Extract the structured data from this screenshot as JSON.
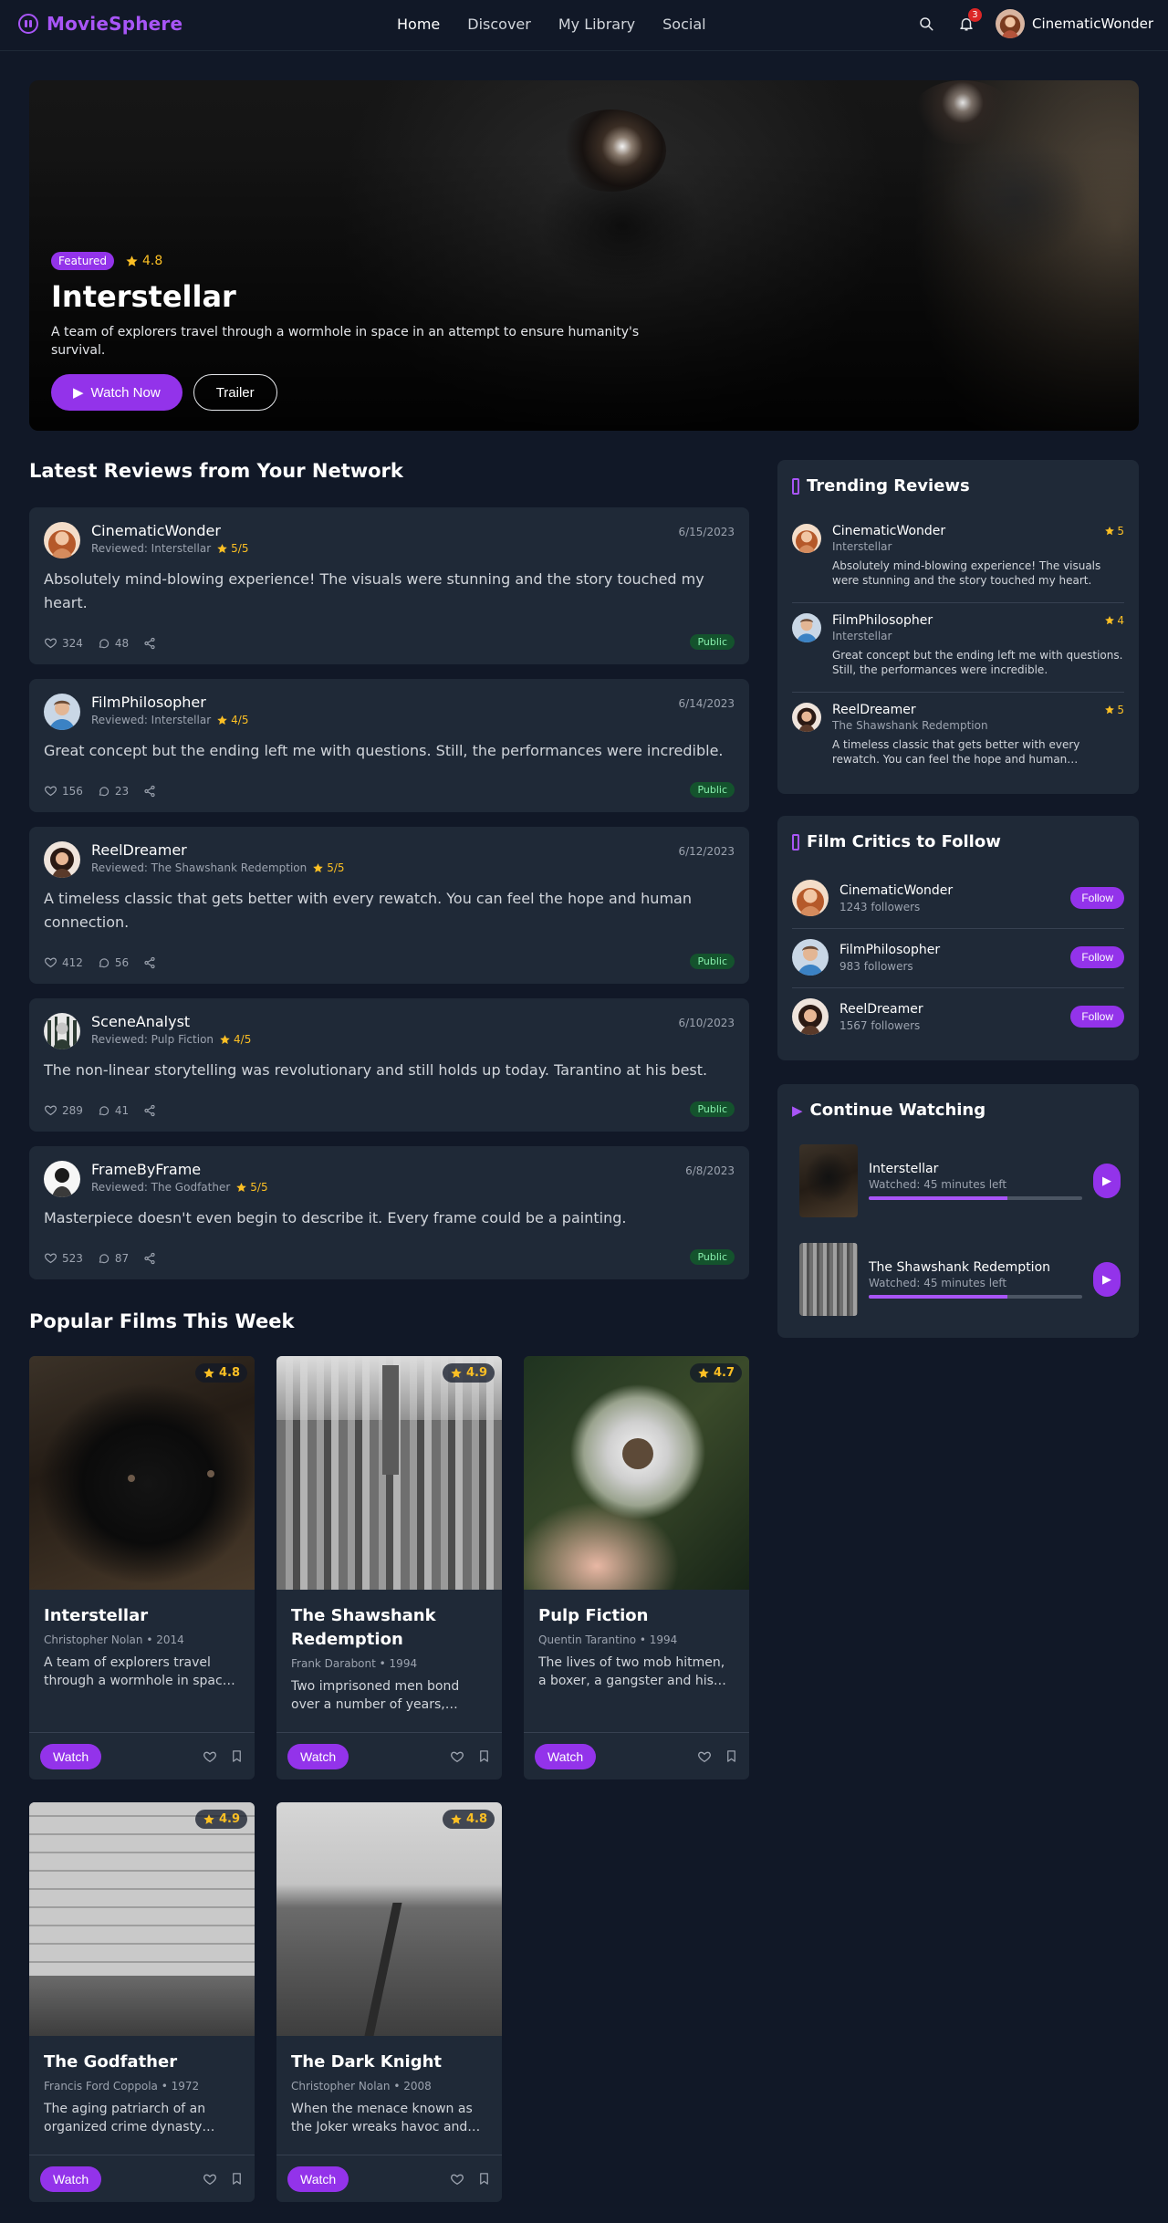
{
  "app": {
    "name": "MovieSphere"
  },
  "nav": {
    "links": [
      "Home",
      "Discover",
      "My Library",
      "Social"
    ],
    "active": "Home",
    "notification_count": "3",
    "user": "CinematicWonder",
    "icons": [
      "search-icon",
      "bell-icon"
    ]
  },
  "hero": {
    "tag": "Featured",
    "rating": "4.8",
    "title": "Interstellar",
    "description": "A team of explorers travel through a wormhole in space in an attempt to ensure humanity's survival.",
    "watch_label": "Watch Now",
    "trailer_label": "Trailer"
  },
  "reviews_section": {
    "title": "Latest Reviews from Your Network",
    "reviews": [
      {
        "user": "CinematicWonder",
        "reviewed": "Reviewed: Interstellar",
        "rating": "5/5",
        "date": "6/15/2023",
        "text": "Absolutely mind-blowing experience! The visuals were stunning and the story touched my heart.",
        "likes": "324",
        "comments": "48",
        "visibility": "Public"
      },
      {
        "user": "FilmPhilosopher",
        "reviewed": "Reviewed: Interstellar",
        "rating": "4/5",
        "date": "6/14/2023",
        "text": "Great concept but the ending left me with questions. Still, the performances were incredible.",
        "likes": "156",
        "comments": "23",
        "visibility": "Public"
      },
      {
        "user": "ReelDreamer",
        "reviewed": "Reviewed: The Shawshank Redemption",
        "rating": "5/5",
        "date": "6/12/2023",
        "text": "A timeless classic that gets better with every rewatch. You can feel the hope and human connection.",
        "likes": "412",
        "comments": "56",
        "visibility": "Public"
      },
      {
        "user": "SceneAnalyst",
        "reviewed": "Reviewed: Pulp Fiction",
        "rating": "4/5",
        "date": "6/10/2023",
        "text": "The non-linear storytelling was revolutionary and still holds up today. Tarantino at his best.",
        "likes": "289",
        "comments": "41",
        "visibility": "Public"
      },
      {
        "user": "FrameByFrame",
        "reviewed": "Reviewed: The Godfather",
        "rating": "5/5",
        "date": "6/8/2023",
        "text": "Masterpiece doesn't even begin to describe it. Every frame could be a painting.",
        "likes": "523",
        "comments": "87",
        "visibility": "Public"
      }
    ]
  },
  "films_section": {
    "title": "Popular Films This Week",
    "watch_label": "Watch",
    "films": [
      {
        "title": "Interstellar",
        "meta": "Christopher Nolan • 2014",
        "rating": "4.8",
        "description": "A team of explorers travel through a wormhole in space in an attempt to ensure humanity's survival."
      },
      {
        "title": "The Shawshank Redemption",
        "meta": "Frank Darabont • 1994",
        "rating": "4.9",
        "description": "Two imprisoned men bond over a number of years, finding solace and eventual redemption through acts of common decency."
      },
      {
        "title": "Pulp Fiction",
        "meta": "Quentin Tarantino • 1994",
        "rating": "4.7",
        "description": "The lives of two mob hitmen, a boxer, a gangster and his wife intertwine in four tales of violence and redemption."
      },
      {
        "title": "The Godfather",
        "meta": "Francis Ford Coppola • 1972",
        "rating": "4.9",
        "description": "The aging patriarch of an organized crime dynasty transfers control of his clandestine empire to his reluctant son."
      },
      {
        "title": "The Dark Knight",
        "meta": "Christopher Nolan • 2008",
        "rating": "4.8",
        "description": "When the menace known as the Joker wreaks havoc and chaos on the people of Gotham, Batman must accept one of the greatest tests."
      }
    ]
  },
  "trending": {
    "title": "Trending Reviews",
    "items": [
      {
        "user": "CinematicWonder",
        "film": "Interstellar",
        "rating": "5",
        "text": "Absolutely mind-blowing experience! The visuals were stunning and the story touched my heart."
      },
      {
        "user": "FilmPhilosopher",
        "film": "Interstellar",
        "rating": "4",
        "text": "Great concept but the ending left me with questions. Still, the performances were incredible."
      },
      {
        "user": "ReelDreamer",
        "film": "The Shawshank Redemption",
        "rating": "5",
        "text": "A timeless classic that gets better with every rewatch. You can feel the hope and human connection."
      }
    ]
  },
  "critics": {
    "title": "Film Critics to Follow",
    "follow_label": "Follow",
    "items": [
      {
        "user": "CinematicWonder",
        "followers": "1243 followers"
      },
      {
        "user": "FilmPhilosopher",
        "followers": "983 followers"
      },
      {
        "user": "ReelDreamer",
        "followers": "1567 followers"
      }
    ]
  },
  "continue_watching": {
    "title": "Continue Watching",
    "items": [
      {
        "title": "Interstellar",
        "status": "Watched: 45 minutes left",
        "progress": 0.65
      },
      {
        "title": "The Shawshank Redemption",
        "status": "Watched: 45 minutes left",
        "progress": 0.65
      }
    ]
  },
  "colors": {
    "accent": "#9333ea",
    "star": "#fbbf24",
    "card": "#1f2937",
    "background": "#111827"
  }
}
